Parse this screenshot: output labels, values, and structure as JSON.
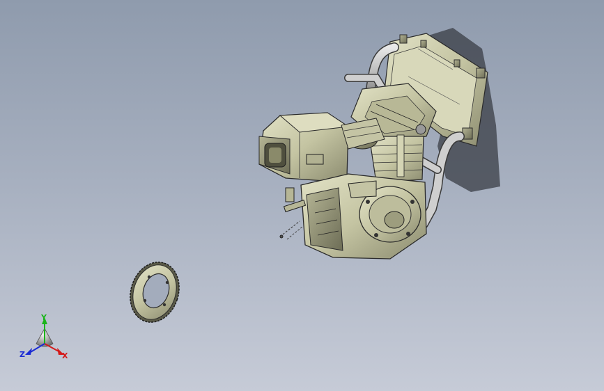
{
  "viewport": {
    "background_top": "#8f9bad",
    "background_bottom": "#c6cbd7"
  },
  "model": {
    "parts": [
      "engine-assembly",
      "radiator",
      "coolant-hoses",
      "air-filter-box",
      "rear-sprocket"
    ],
    "metal_color": "#c9c9a8",
    "edge_color": "#2a2a2a",
    "shadow_color": "#3a3e46"
  },
  "triad": {
    "x_label": "X",
    "y_label": "Y",
    "z_label": "Z",
    "x_color": "#d41a1a",
    "y_color": "#1bb51b",
    "z_color": "#1a2bd4"
  }
}
